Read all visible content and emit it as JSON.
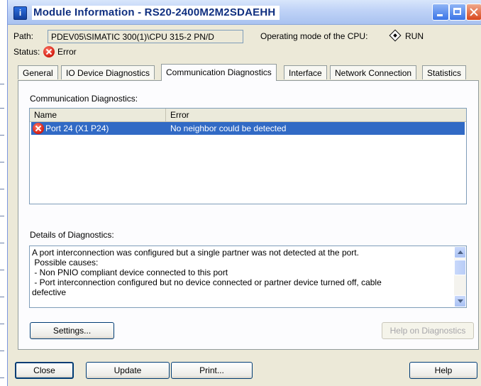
{
  "window": {
    "title": "Module Information - RS20-2400M2M2SDAEHH",
    "icon": "module-info-icon"
  },
  "info": {
    "path_label": "Path:",
    "path_value": "PDEV05\\SIMATIC 300(1)\\CPU 315-2 PN/D",
    "opmode_label": "Operating mode of the CPU:",
    "opmode_value": "RUN",
    "status_label": "Status:",
    "status_value": "Error"
  },
  "tabs": [
    {
      "label": "General"
    },
    {
      "label": "IO Device Diagnostics"
    },
    {
      "label": "Communication Diagnostics",
      "active": true
    },
    {
      "label": "Interface"
    },
    {
      "label": "Network Connection"
    },
    {
      "label": "Statistics"
    }
  ],
  "comm": {
    "section_label": "Communication Diagnostics:",
    "columns": [
      "Name",
      "Error"
    ],
    "rows": [
      {
        "name": "Port 24 (X1 P24)",
        "error": "No neighbor could be detected",
        "selected": true
      }
    ]
  },
  "details": {
    "section_label": "Details of Diagnostics:",
    "text": "A port interconnection was configured but a single partner was not detected at the port.\n Possible causes:\n - Non PNIO compliant device connected to this port\n - Port interconnection configured but no device connected or partner device turned off, cable\ndefective"
  },
  "buttons": {
    "settings": "Settings...",
    "help_diag": "Help on Diagnostics",
    "close": "Close",
    "update": "Update",
    "print": "Print...",
    "help": "Help"
  },
  "colors": {
    "selection": "#316ac5",
    "error_icon": "#d21c10",
    "title_text": "#0f2f80"
  }
}
